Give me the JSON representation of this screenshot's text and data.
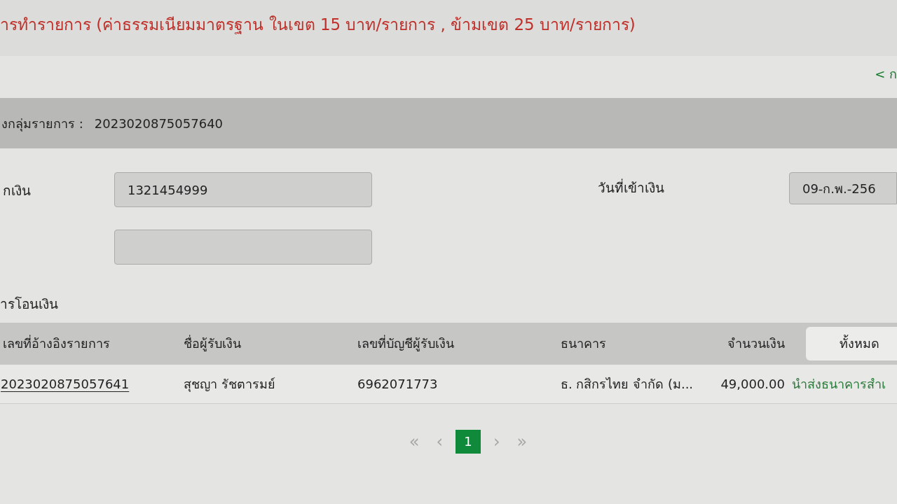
{
  "notice": "ารทำรายการ (ค่าธรรมเนียมมาตรฐาน ในเขต 15 บาท/รายการ , ข้ามเขต 25 บาท/รายการ)",
  "back_link": "< ก",
  "group_bar": {
    "label": "งกลุ่มรายการ :",
    "value": "2023020875057640"
  },
  "form": {
    "account_label": "กเงิน",
    "account_value": "1321454999",
    "date_label": "วันที่เข้าเงิน",
    "date_value": "09-ก.พ.-256"
  },
  "section_title": "ารโอนเงิน",
  "table": {
    "columns": [
      "เลขที่อ้างอิงรายการ",
      "ชื่อผู้รับเงิน",
      "เลขที่บัญชีผู้รับเงิน",
      "ธนาคาร",
      "จำนวนเงิน"
    ],
    "status_filter": "ทั้งหมด",
    "rows": [
      {
        "reference": "2023020875057641",
        "payee": "สุชญา รัชตารมย์",
        "account": "6962071773",
        "bank": "ธ. กสิกรไทย จำกัด (ม...",
        "amount": "49,000.00",
        "status": "นำส่งธนาคารสำเ"
      }
    ]
  },
  "pagination": {
    "first": "«",
    "prev": "‹",
    "pages": [
      {
        "label": "1",
        "selected": true
      }
    ],
    "next": "›",
    "last": "»"
  }
}
